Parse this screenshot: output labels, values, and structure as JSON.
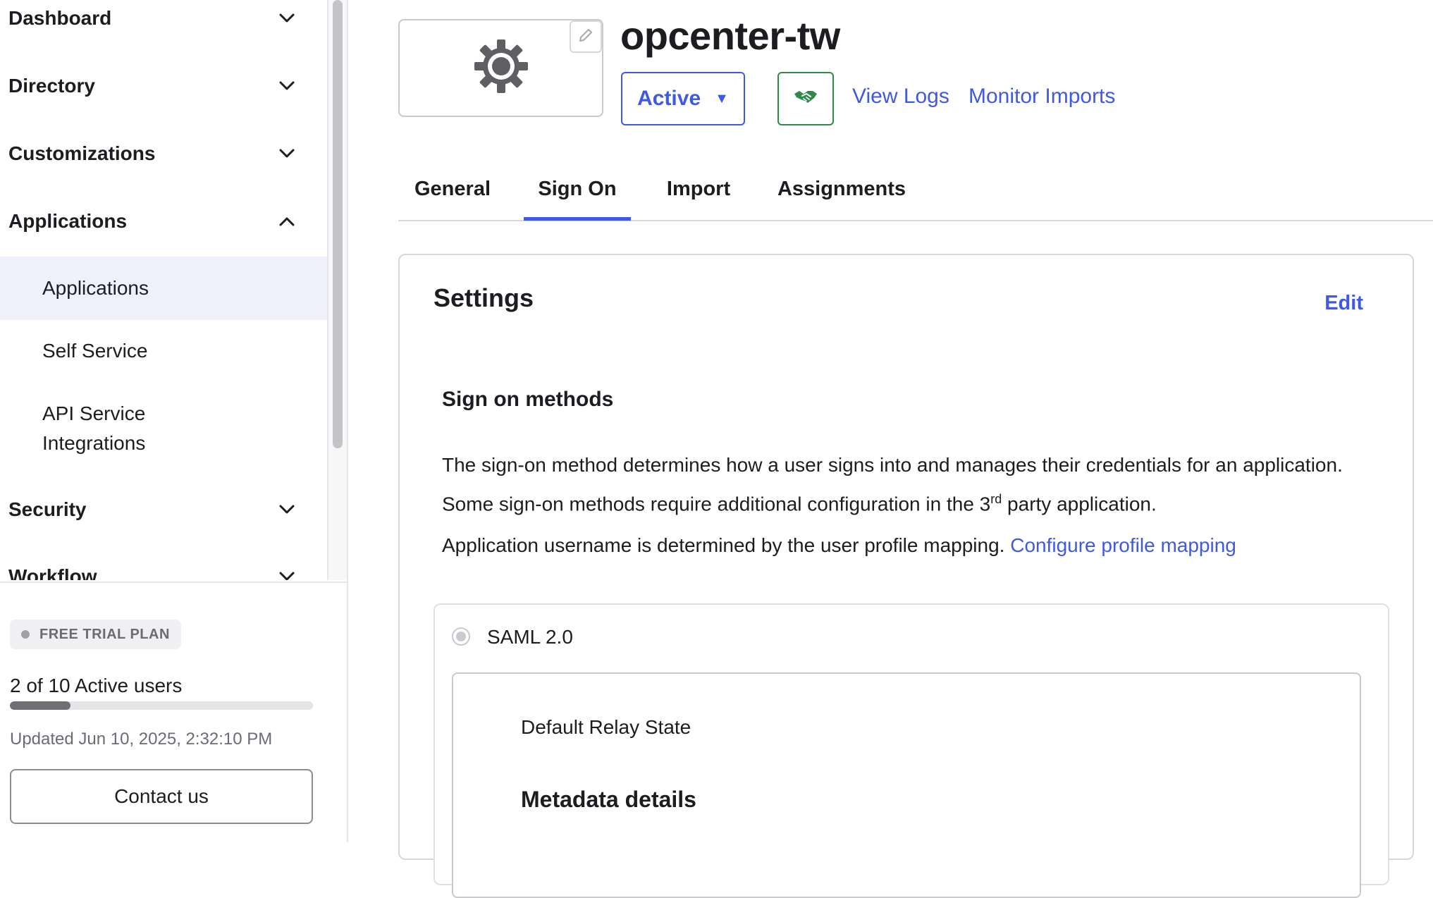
{
  "sidebar": {
    "sections": [
      {
        "label": "Dashboard",
        "expanded": false
      },
      {
        "label": "Directory",
        "expanded": false
      },
      {
        "label": "Customizations",
        "expanded": false
      },
      {
        "label": "Applications",
        "expanded": true
      },
      {
        "label": "Security",
        "expanded": false
      },
      {
        "label": "Workflow",
        "expanded": false
      }
    ],
    "applications_children": [
      {
        "label": "Applications",
        "active": true
      },
      {
        "label": "Self Service",
        "active": false
      },
      {
        "label": "API Service Integrations",
        "active": false
      }
    ],
    "footer": {
      "plan_badge": "FREE TRIAL PLAN",
      "users_text": "2 of 10 Active users",
      "users_active": 2,
      "users_total": 10,
      "updated_text": "Updated Jun 10, 2025, 2:32:10 PM",
      "contact_label": "Contact us"
    }
  },
  "app": {
    "title": "opcenter-tw",
    "logo_icon": "gear-icon",
    "status_label": "Active",
    "status_caret": "▼",
    "links": {
      "view_logs": "View Logs",
      "monitor_imports": "Monitor Imports"
    }
  },
  "tabs": [
    {
      "label": "General",
      "active": false
    },
    {
      "label": "Sign On",
      "active": true
    },
    {
      "label": "Import",
      "active": false
    },
    {
      "label": "Assignments",
      "active": false
    }
  ],
  "settings": {
    "title": "Settings",
    "edit_label": "Edit",
    "sign_on_heading": "Sign on methods",
    "description_part1": "The sign-on method determines how a user signs into and manages their credentials for an application. Some sign-on methods require additional configuration in the 3",
    "description_sup": "rd",
    "description_part2": " party application.",
    "mapping_text": "Application username is determined by the user profile mapping.",
    "mapping_link": "Configure profile mapping",
    "method_label": "SAML 2.0",
    "relay_state_label": "Default Relay State",
    "metadata_heading": "Metadata details"
  },
  "colors": {
    "accent": "#3f59e4",
    "success": "#2f8a4a",
    "active_bg": "#eef1fb"
  }
}
